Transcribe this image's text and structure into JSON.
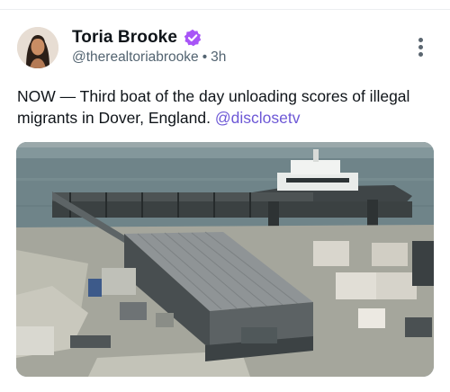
{
  "author": {
    "display_name": "Toria Brooke",
    "handle": "@therealtoriabrooke",
    "timestamp": "3h",
    "verified": true,
    "verified_color": "#a855f7"
  },
  "post": {
    "text": "NOW — Third boat of the day unloading scores of illegal migrants in Dover, England.",
    "mention": "@disclosetv",
    "mention_color": "#6d58d6"
  },
  "icons": {
    "more": "more-vertical-icon",
    "verified": "verified-badge-icon"
  },
  "media": {
    "alt": "Aerial photo of a boat docked beside a harbour pontoon in Dover with port buildings and cabins"
  }
}
